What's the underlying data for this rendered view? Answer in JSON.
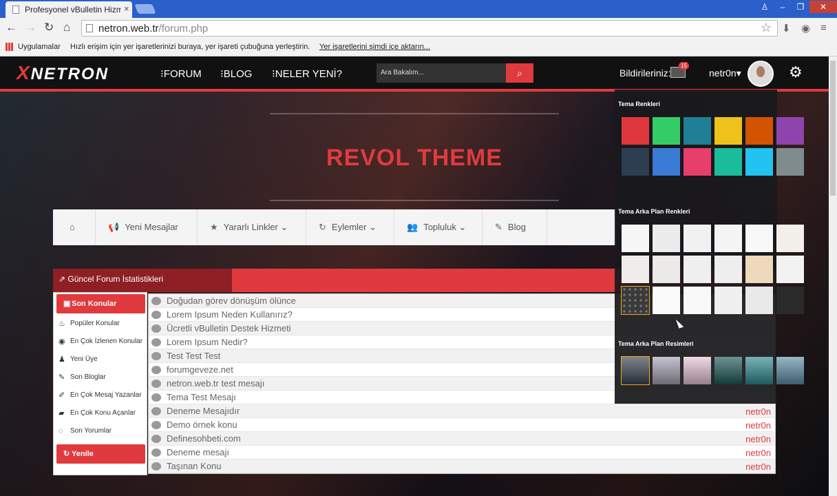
{
  "browser": {
    "tab_title": "Profesyonel vBulletin Hizm",
    "url_host": "netron.web.tr",
    "url_path": "/forum.php",
    "bookmarks_apps": "Uygulamalar",
    "bookmarks_hint": "Hızlı erişim için yer işaretlerinizi buraya, yer işareti çubuğuna yerleştirin.",
    "bookmarks_import": "Yer işaretlerini şimdi içe aktarın..."
  },
  "header": {
    "logo": "NETRON",
    "menu": [
      "FORUM",
      "BLOG",
      "NELER YENİ?"
    ],
    "search_placeholder": "Ara Bakalım...",
    "notifications_label": "Bildirileriniz:",
    "notifications_count": "15",
    "username": "netr0n"
  },
  "hero": {
    "subtitle": "",
    "title": "REVOL       THEME",
    "tagline": ""
  },
  "subnav": [
    "Yeni Mesajlar",
    "Yararlı Linkler",
    "Eylemler",
    "Topluluk",
    "Blog"
  ],
  "stats": {
    "title": "Güncel Forum İstatistikleri",
    "left_menu": {
      "active": "Son Konular",
      "items": [
        "Popüler Konular",
        "En Çok İzlenen Konular",
        "Yeni Üye",
        "Son Bloglar",
        "En Çok Mesaj Yazanlar",
        "En Çok Konu Açanlar",
        "Son Yorumlar"
      ],
      "refresh": "Yenile"
    },
    "topics": [
      {
        "title": "Doğudan görev dönüşüm ölünce",
        "author": ""
      },
      {
        "title": "Lorem Ipsum Neden Kullanırız?",
        "author": ""
      },
      {
        "title": "Ücretli vBulletin Destek Hizmeti",
        "author": ""
      },
      {
        "title": "Lorem Ipsum Nedir?",
        "author": ""
      },
      {
        "title": "Test Test Test",
        "author": ""
      },
      {
        "title": "forumgeveze.net",
        "author": ""
      },
      {
        "title": "netron.web.tr test mesajı",
        "author": ""
      },
      {
        "title": "Tema Test Mesajı",
        "author": ""
      },
      {
        "title": "Deneme Mesajıdır",
        "author": "netr0n"
      },
      {
        "title": "Demo örnek konu",
        "author": "netr0n"
      },
      {
        "title": "Definesohbeti.com",
        "author": "netr0n"
      },
      {
        "title": "Deneme mesajı",
        "author": "netr0n"
      },
      {
        "title": "Taşınan Konu",
        "author": "netr0n"
      }
    ]
  },
  "theme_panel": {
    "colors_title": "Tema Renkleri",
    "bg_colors_title": "Tema Arka Plan Renkleri",
    "bg_images_title": "Tema Arka Plan Resimleri",
    "colors": [
      "#e0373d",
      "#33cc66",
      "#1f7f95",
      "#eec21a",
      "#d35400",
      "#8e44ad",
      "#2c3e50",
      "#3a7bd5",
      "#e83e6c",
      "#1abc9c",
      "#22c3f0",
      "#7f8c8d"
    ],
    "bg_colors": [
      "#f7f7f7",
      "#ececec",
      "#f1f1f1",
      "#f4f4f4",
      "#f8f8f8",
      "#f3efea",
      "#f1ecec",
      "#ece9e9",
      "#efefef",
      "#eeeeee",
      "#efd9bd",
      "#f2f2f2",
      "#3a3a3a",
      "#fbfbfb",
      "#f9f9f9",
      "#f0f0f0",
      "#e9e9e9",
      "#2a2a2a"
    ],
    "bg_images": [
      "#3b4450",
      "#a7a3b3",
      "#e6c5d6",
      "#1d5a58",
      "#2e8b90",
      "#5f8fa8"
    ]
  }
}
